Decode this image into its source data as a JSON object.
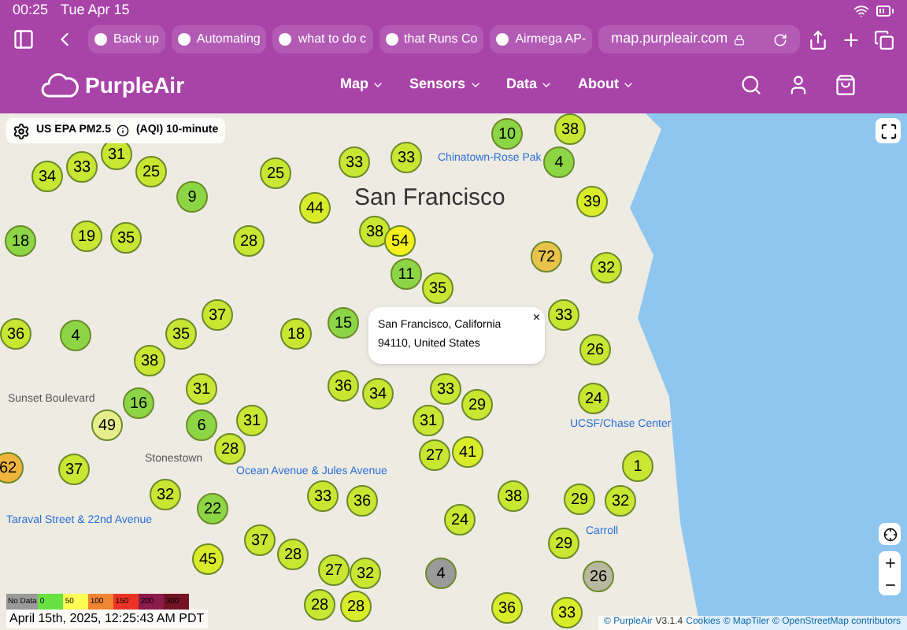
{
  "status_bar": {
    "time": "00:25",
    "date": "Tue Apr 15"
  },
  "browser_tabs": [
    {
      "label": "Back up",
      "selected": false
    },
    {
      "label": "Automating",
      "selected": false
    },
    {
      "label": "what to do c",
      "selected": false
    },
    {
      "label": "that Runs Co",
      "selected": false
    },
    {
      "label": "Airmega AP-",
      "selected": false
    }
  ],
  "address_bar": {
    "url": "map.purpleair.com"
  },
  "site_header": {
    "logo": "PurpleAir",
    "nav": [
      {
        "label": "Map"
      },
      {
        "label": "Sensors"
      },
      {
        "label": "Data"
      },
      {
        "label": "About"
      }
    ]
  },
  "map": {
    "layer_label": "US EPA PM2.5",
    "layer_unit": "(AQI) 10-minute",
    "places": [
      {
        "name": "San Francisco",
        "kind": "city"
      },
      {
        "name": "Chinatown-Rose Pak",
        "kind": "transit"
      },
      {
        "name": "UCSF/Chase Center",
        "kind": "transit"
      },
      {
        "name": "Stonestown",
        "kind": "street"
      },
      {
        "name": "Ocean Avenue & Jules Avenue",
        "kind": "transit"
      },
      {
        "name": "Carroll",
        "kind": "transit"
      },
      {
        "name": "Sunset Boulevard",
        "kind": "street"
      },
      {
        "name": "Taraval Street & 22nd Avenue",
        "kind": "transit"
      }
    ],
    "markers": [
      {
        "value": "34",
        "color": "#c8e632"
      },
      {
        "value": "33",
        "color": "#c8e632"
      },
      {
        "value": "31",
        "color": "#c8e632"
      },
      {
        "value": "25",
        "color": "#c8e632"
      },
      {
        "value": "9",
        "color": "#8cd646"
      },
      {
        "value": "25",
        "color": "#c8e632"
      },
      {
        "value": "33",
        "color": "#c8e632"
      },
      {
        "value": "44",
        "color": "#d9ec2a"
      },
      {
        "value": "38",
        "color": "#c8e632"
      },
      {
        "value": "18",
        "color": "#8cd646"
      },
      {
        "value": "19",
        "color": "#c8e632"
      },
      {
        "value": "35",
        "color": "#c8e632"
      },
      {
        "value": "28",
        "color": "#c8e632"
      },
      {
        "value": "54",
        "color": "#f3ee1c"
      },
      {
        "value": "11",
        "color": "#8cd646"
      },
      {
        "value": "35",
        "color": "#c8e632"
      },
      {
        "value": "39",
        "color": "#d9ec2a"
      },
      {
        "value": "4",
        "color": "#8cd646"
      },
      {
        "value": "38",
        "color": "#c8e632"
      },
      {
        "value": "10",
        "color": "#8cd646"
      },
      {
        "value": "33",
        "color": "#c8e632"
      },
      {
        "value": "72",
        "color": "#e8c24a"
      },
      {
        "value": "32",
        "color": "#c8e632"
      },
      {
        "value": "36",
        "color": "#c8e632"
      },
      {
        "value": "4",
        "color": "#8cd646"
      },
      {
        "value": "35",
        "color": "#c8e632"
      },
      {
        "value": "37",
        "color": "#c8e632"
      },
      {
        "value": "38",
        "color": "#c8e632"
      },
      {
        "value": "18",
        "color": "#c8e632"
      },
      {
        "value": "15",
        "color": "#8cd646"
      },
      {
        "value": "16",
        "color": "#8cd646"
      },
      {
        "value": "31",
        "color": "#c8e632"
      },
      {
        "value": "36",
        "color": "#c8e632"
      },
      {
        "value": "34",
        "color": "#c8e632"
      },
      {
        "value": "33",
        "color": "#c8e632"
      },
      {
        "value": "29",
        "color": "#c8e632"
      },
      {
        "value": "26",
        "color": "#c8e632"
      },
      {
        "value": "33",
        "color": "#c8e632"
      },
      {
        "value": "24",
        "color": "#c8e632"
      },
      {
        "value": "49",
        "color": "#e6ee8c"
      },
      {
        "value": "6",
        "color": "#8cd646"
      },
      {
        "value": "31",
        "color": "#c8e632"
      },
      {
        "value": "28",
        "color": "#c8e632"
      },
      {
        "value": "31",
        "color": "#c8e632"
      },
      {
        "value": "27",
        "color": "#c8e632"
      },
      {
        "value": "41",
        "color": "#d9ec2a"
      },
      {
        "value": "62",
        "color": "#f0b43c"
      },
      {
        "value": "37",
        "color": "#c8e632"
      },
      {
        "value": "32",
        "color": "#c8e632"
      },
      {
        "value": "22",
        "color": "#8cd646"
      },
      {
        "value": "33",
        "color": "#c8e632"
      },
      {
        "value": "36",
        "color": "#c8e632"
      },
      {
        "value": "38",
        "color": "#c8e632"
      },
      {
        "value": "24",
        "color": "#c8e632"
      },
      {
        "value": "1",
        "color": "#c8e632"
      },
      {
        "value": "29",
        "color": "#c8e632"
      },
      {
        "value": "32",
        "color": "#c8e632"
      },
      {
        "value": "29",
        "color": "#c8e632"
      },
      {
        "value": "37",
        "color": "#c8e632"
      },
      {
        "value": "45",
        "color": "#d9ec2a"
      },
      {
        "value": "28",
        "color": "#c8e632"
      },
      {
        "value": "27",
        "color": "#c8e632"
      },
      {
        "value": "32",
        "color": "#c8e632"
      },
      {
        "value": "4",
        "color": "#9a9a9a"
      },
      {
        "value": "28",
        "color": "#c8e632"
      },
      {
        "value": "28",
        "color": "#d9ec2a"
      },
      {
        "value": "36",
        "color": "#d9ec2a"
      },
      {
        "value": "33",
        "color": "#d9ec2a"
      },
      {
        "value": "26",
        "color": "#b8b8a0"
      }
    ],
    "popup": {
      "text": "San Francisco, California 94110, United States",
      "close": "×"
    },
    "legend": {
      "steps": [
        {
          "label": "No Data",
          "color": "#9a9a9a"
        },
        {
          "label": "0",
          "color": "#68e143"
        },
        {
          "label": "50",
          "color": "#ffff55"
        },
        {
          "label": "100",
          "color": "#ef8533"
        },
        {
          "label": "150",
          "color": "#ea3324"
        },
        {
          "label": "200",
          "color": "#8c1a4b"
        },
        {
          "label": "300",
          "color": "#731425"
        }
      ],
      "timestamp": "April 15th, 2025, 12:25:43 AM PDT"
    },
    "attribution": [
      {
        "label": "© PurpleAir",
        "kind": "link"
      },
      {
        "label": "V3.1.4",
        "kind": "text"
      },
      {
        "label": "Cookies",
        "kind": "link"
      },
      {
        "label": "© MapTiler",
        "kind": "link"
      },
      {
        "label": "© OpenStreetMap contributors",
        "kind": "link"
      }
    ]
  }
}
